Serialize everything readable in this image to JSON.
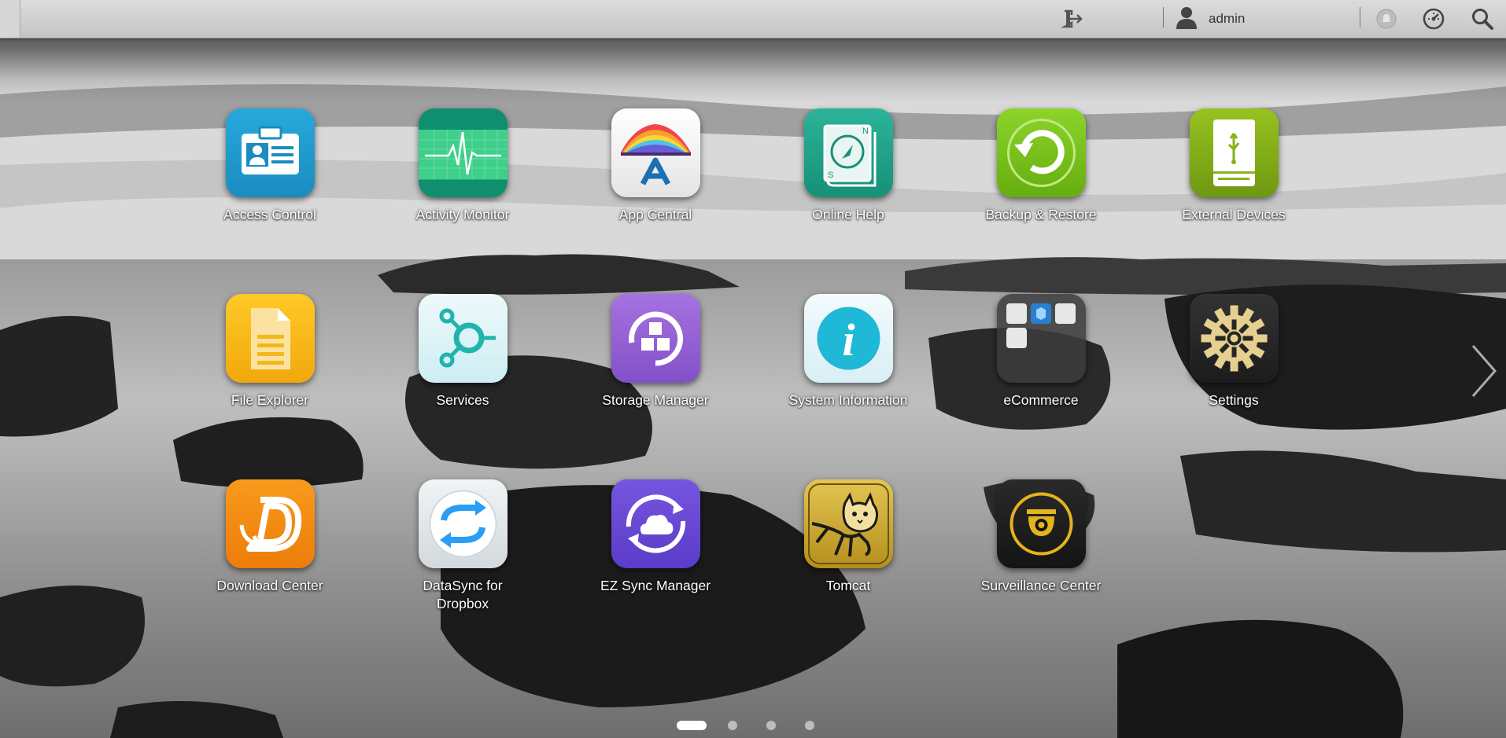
{
  "topbar": {
    "user_label": "admin"
  },
  "icons": {
    "topbar": [
      "sign-out-icon",
      "user-icon",
      "notification-icon",
      "dashboard-icon",
      "search-icon"
    ],
    "pager_next": "chevron-right-icon"
  },
  "apps": [
    {
      "label": "Access Control",
      "icon": "id-card-icon",
      "color": "#1e9bd0"
    },
    {
      "label": "Activity Monitor",
      "icon": "heartbeat-icon",
      "color": "#14a07a"
    },
    {
      "label": "App Central",
      "icon": "rainbow-a-icon",
      "color": "#f0f0f0"
    },
    {
      "label": "Online Help",
      "icon": "compass-book-icon",
      "color": "#1fa58a"
    },
    {
      "label": "Backup & Restore",
      "icon": "backup-cycle-icon",
      "color": "#7cc31a"
    },
    {
      "label": "External Devices",
      "icon": "usb-drive-icon",
      "color": "#86b21a"
    },
    {
      "label": "File Explorer",
      "icon": "document-icon",
      "color": "#f5b81a"
    },
    {
      "label": "Services",
      "icon": "services-nodes-icon",
      "color": "#dff3f6"
    },
    {
      "label": "Storage Manager",
      "icon": "storage-blocks-icon",
      "color": "#9a63d6"
    },
    {
      "label": "System Information",
      "icon": "info-icon",
      "color": "#e6f4f7"
    },
    {
      "label": "eCommerce",
      "icon": "ecommerce-folder-icon",
      "color": "#3a3a3a"
    },
    {
      "label": "Settings",
      "icon": "gear-icon",
      "color": "#262626"
    },
    {
      "label": "Download Center",
      "icon": "download-d-icon",
      "color": "#f08a12"
    },
    {
      "label": "DataSync for Dropbox",
      "icon": "sync-arrows-icon",
      "color": "#e3e8ea"
    },
    {
      "label": "EZ Sync Manager",
      "icon": "cloud-sync-icon",
      "color": "#6a4fd6"
    },
    {
      "label": "Tomcat",
      "icon": "tomcat-cat-icon",
      "color": "#c9a22c"
    },
    {
      "label": "Surveillance Center",
      "icon": "camera-icon",
      "color": "#1c1c1c"
    }
  ],
  "pager": {
    "pages": 4,
    "current": 1
  }
}
